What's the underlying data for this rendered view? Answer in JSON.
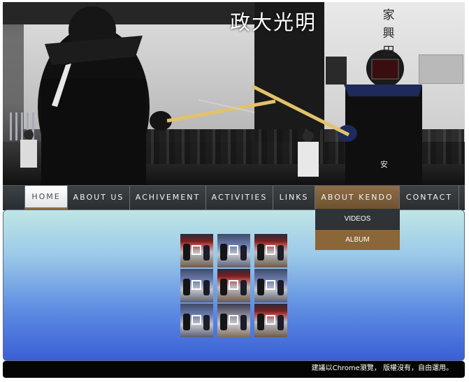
{
  "banner": {
    "title": "政大光明",
    "vertical_text": "家興田"
  },
  "nav": {
    "items": [
      {
        "label": "HOME"
      },
      {
        "label": "ABOUT US"
      },
      {
        "label": "ACHIVEMENT"
      },
      {
        "label": "ACTIVITIES"
      },
      {
        "label": "LINKS"
      },
      {
        "label": "ABOUT KENDO"
      },
      {
        "label": "CONTACT"
      }
    ],
    "active": "ABOUT KENDO",
    "dropdown": [
      {
        "label": "VIDEOS"
      },
      {
        "label": "ALBUM"
      }
    ]
  },
  "gallery": {
    "thumbnails": [
      {
        "icon": "image-frame-icon"
      },
      {
        "icon": "image-frame-icon"
      },
      {
        "icon": "image-frame-icon"
      },
      {
        "icon": "image-frame-icon"
      },
      {
        "icon": "image-frame-icon"
      },
      {
        "icon": "image-frame-icon"
      },
      {
        "icon": "image-frame-icon"
      },
      {
        "icon": "image-frame-icon"
      },
      {
        "icon": "image-frame-icon"
      }
    ]
  },
  "footer": {
    "text": "建議以Chrome瀏覽， 版權沒有，自由運用。"
  },
  "colors": {
    "nav_bg": "#2f3236",
    "nav_active": "#8a6638",
    "footer_bg": "#050505",
    "content_top": "#bfe6e6",
    "content_bottom": "#3a5fd6"
  }
}
